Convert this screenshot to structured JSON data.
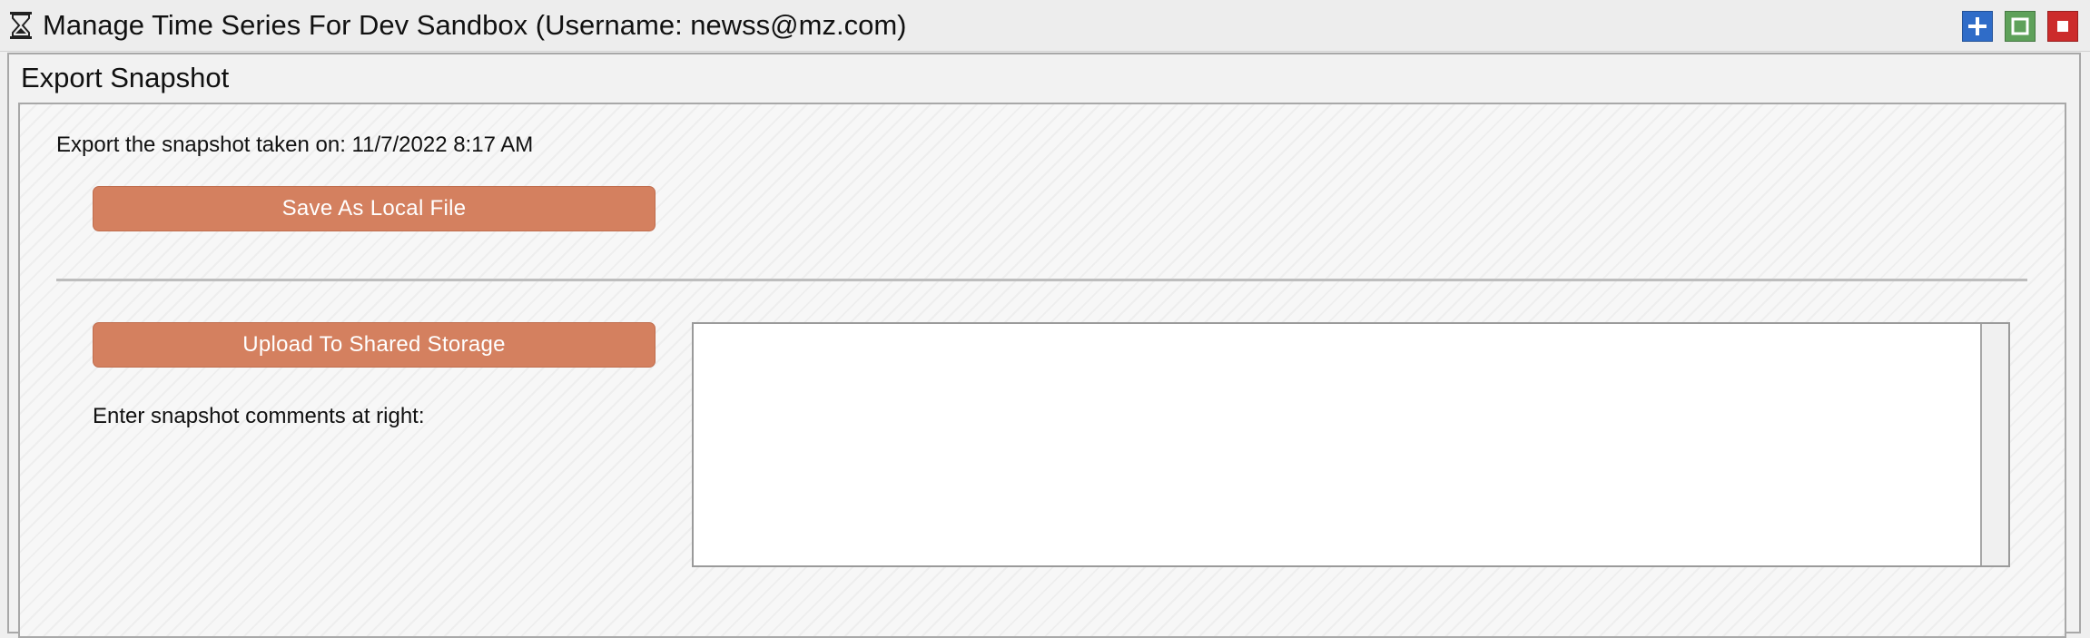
{
  "window": {
    "title": "Manage Time Series For Dev Sandbox (Username: newss@mz.com)",
    "title_icon": "hourglass-icon",
    "controls": [
      {
        "name": "add",
        "icon": "plus-icon",
        "color": "#2f6cc8"
      },
      {
        "name": "maximize",
        "icon": "square-icon",
        "color": "#5ea15a"
      },
      {
        "name": "close",
        "icon": "stop-icon",
        "color": "#cc2b2b"
      }
    ]
  },
  "panel": {
    "heading": "Export Snapshot",
    "export_label": "Export the snapshot taken on: 11/7/2022 8:17 AM",
    "save_button": "Save As Local File",
    "upload_button": "Upload To Shared Storage",
    "comments_label": "Enter snapshot comments at right:",
    "comments_value": ""
  },
  "colors": {
    "action_button": "#d4805f",
    "action_button_text": "#ffffff"
  }
}
